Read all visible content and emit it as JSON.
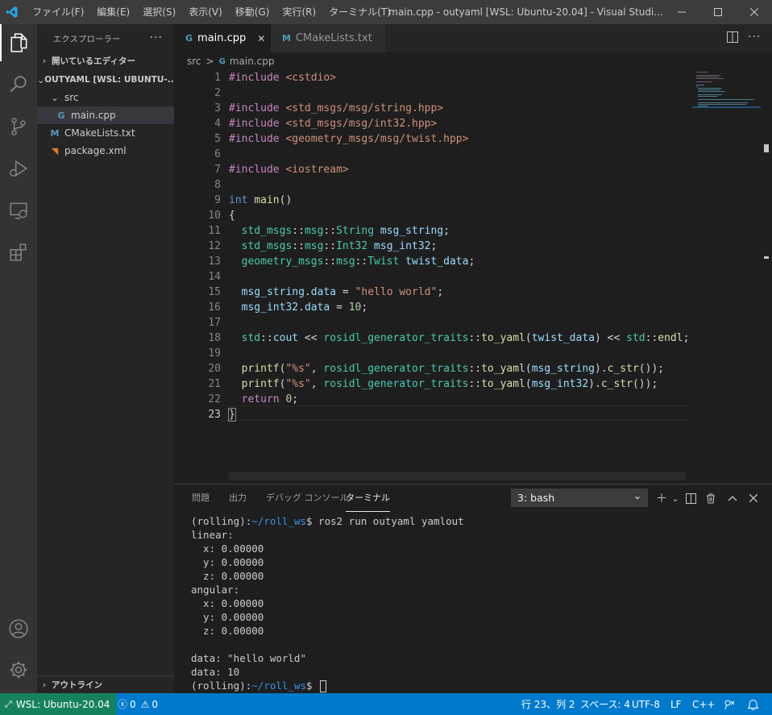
{
  "window": {
    "title": "main.cpp - outyaml [WSL: Ubuntu-20.04] - Visual Studi...",
    "menu": [
      "ファイル(F)",
      "編集(E)",
      "選択(S)",
      "表示(V)",
      "移動(G)",
      "実行(R)",
      "ターミナル(T)",
      "…"
    ]
  },
  "activity_bar": [
    "explorer-icon",
    "search-icon",
    "source-control-icon",
    "run-debug-icon",
    "remote-explorer-icon",
    "extensions-icon",
    "account-icon",
    "settings-gear-icon"
  ],
  "sidebar": {
    "title": "エクスプローラー",
    "more": "···",
    "open_editors": "開いているエディター",
    "folder": "OUTYAML [WSL: UBUNTU-...",
    "tree": [
      {
        "label": "src",
        "icon": "chevron-down-icon"
      },
      {
        "label": "main.cpp",
        "icon": "cpp-file-icon"
      },
      {
        "label": "CMakeLists.txt",
        "icon": "cmake-icon"
      },
      {
        "label": "package.xml",
        "icon": "rss-xml-icon"
      }
    ],
    "outline": "アウトライン"
  },
  "tabs": [
    {
      "label": "main.cpp",
      "icon_glyph": "G",
      "close": "✕"
    },
    {
      "label": "CMakeLists.txt",
      "icon_glyph": "M"
    }
  ],
  "breadcrumb": {
    "folder": "src",
    "sep": ">",
    "file": "main.cpp",
    "icon_glyph": "G"
  },
  "editor": {
    "line_numbers": [
      "1",
      "2",
      "3",
      "4",
      "5",
      "6",
      "7",
      "8",
      "9",
      "10",
      "11",
      "12",
      "13",
      "14",
      "15",
      "16",
      "17",
      "18",
      "19",
      "20",
      "21",
      "22",
      "23"
    ],
    "current_line": 23
  },
  "panel": {
    "tabs": [
      "問題",
      "出力",
      "デバッグ コンソール",
      "ターミナル"
    ],
    "active_tab": "ターミナル",
    "terminal_select": "3: bash",
    "prompt_user": "(rolling):",
    "prompt_path": "~/roll_ws",
    "prompt_symbol": "$",
    "command": " ros2 run outyaml yamlout",
    "output": [
      "linear:",
      "  x: 0.00000",
      "  y: 0.00000",
      "  z: 0.00000",
      "angular:",
      "  x: 0.00000",
      "  y: 0.00000",
      "  z: 0.00000",
      "",
      "data: \"hello world\"",
      "data: 10"
    ]
  },
  "statusbar": {
    "remote": "WSL: Ubuntu-20.04",
    "errors": "0",
    "warnings": "0",
    "position": "行 23、列 2",
    "indent": "スペース: 4",
    "encoding": "UTF-8",
    "eol": "LF",
    "language": "C++"
  },
  "colors": {
    "accent": "#007acc",
    "remote": "#16825d",
    "activity_bar": "#333333",
    "sidebar": "#252526",
    "editor": "#1e1e1e"
  }
}
